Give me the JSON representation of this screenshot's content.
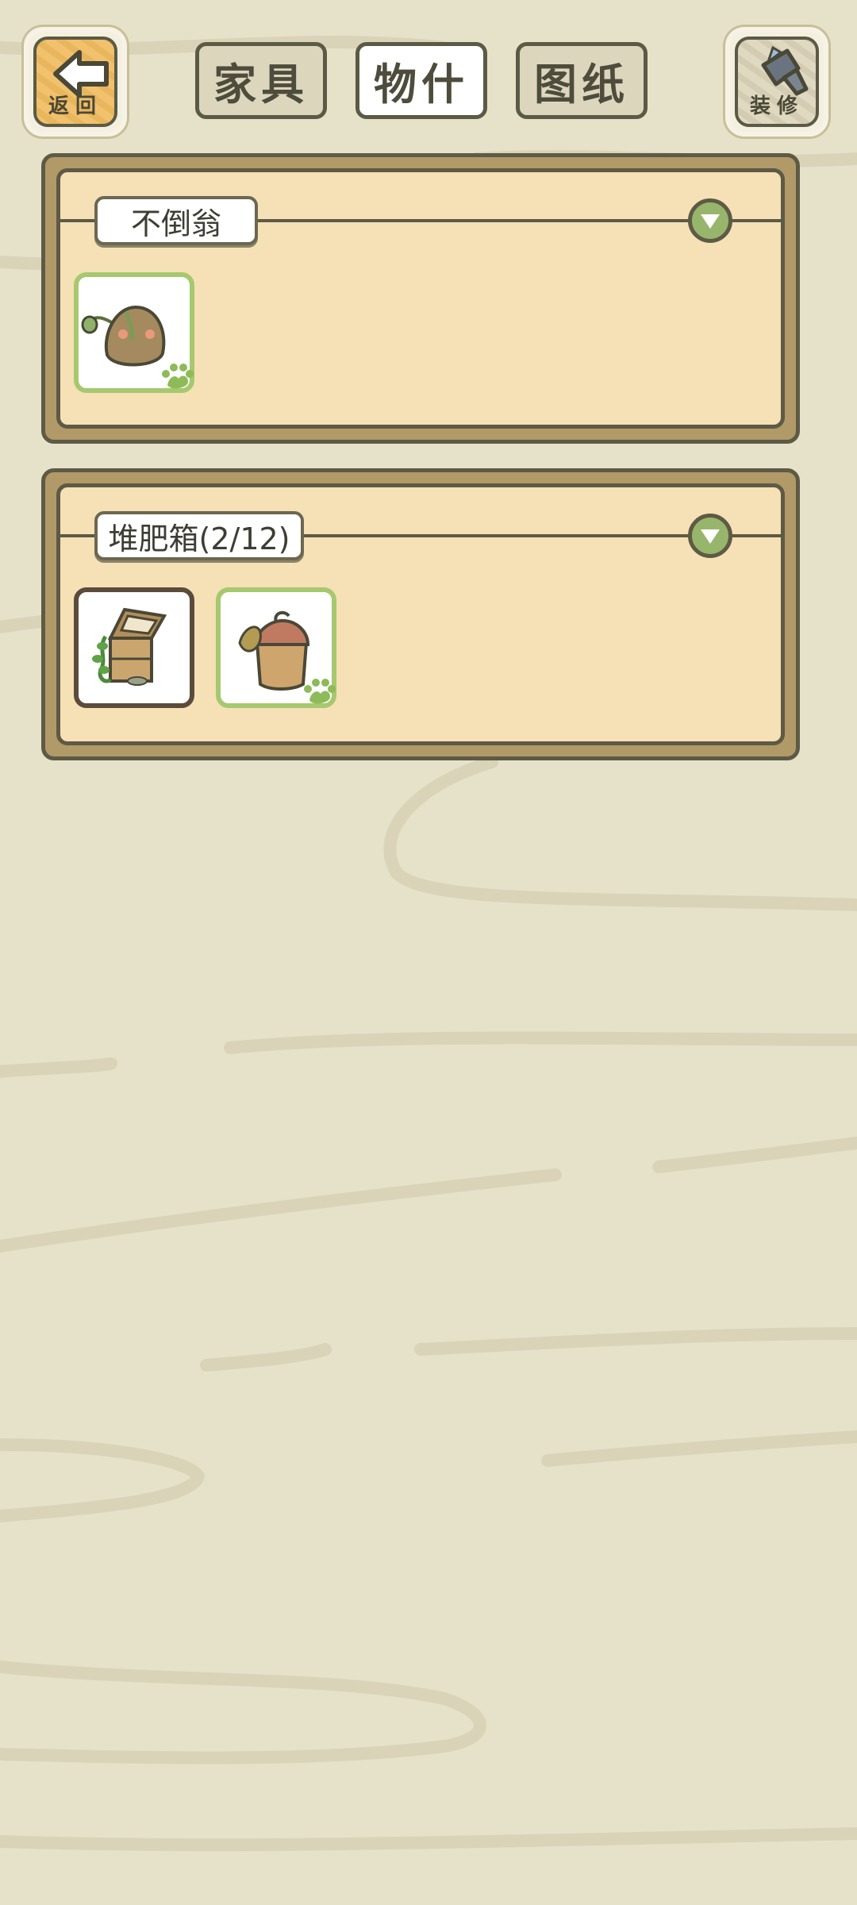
{
  "header": {
    "back_label": "返回",
    "decorate_label": "装修",
    "tabs": [
      {
        "label": "家具",
        "active": false
      },
      {
        "label": "物什",
        "active": true
      },
      {
        "label": "图纸",
        "active": false
      }
    ]
  },
  "sections": [
    {
      "title": "不倒翁",
      "items": [
        {
          "icon": "tumbler-toy-icon",
          "owned": true
        }
      ]
    },
    {
      "title": "堆肥箱(2/12)",
      "items": [
        {
          "icon": "compost-box-icon",
          "owned": false
        },
        {
          "icon": "compost-bag-icon",
          "owned": true
        }
      ]
    }
  ],
  "colors": {
    "background": "#e6e2ca",
    "panel_border": "#b19a68",
    "panel_fill": "#f6e0b5",
    "owned_border": "#a6c86f",
    "accent_green": "#98b56c"
  }
}
